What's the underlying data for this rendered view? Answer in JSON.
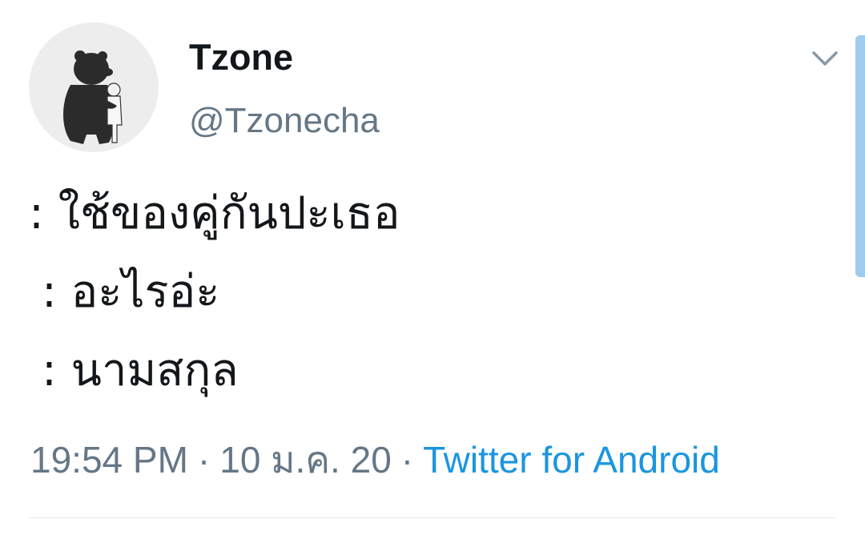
{
  "tweet": {
    "author": {
      "display_name": "Tzone",
      "handle": "@Tzonecha",
      "avatar_icon": "bear-hug-avatar"
    },
    "menu_icon": "chevron-down-icon",
    "lines": [
      ": ใช้ของคู่กันปะเธอ",
      ": อะไรอ่ะ",
      ": นามสกุล"
    ],
    "meta": {
      "time": "19:54 PM",
      "separator": "·",
      "date": "10 ม.ค. 20",
      "source": "Twitter for Android"
    }
  },
  "colors": {
    "text_primary": "#14171a",
    "text_secondary": "#657786",
    "link": "#1b95e0",
    "scrollbar": "#9ecbee"
  }
}
